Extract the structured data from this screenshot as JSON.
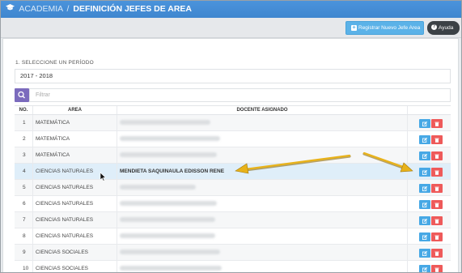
{
  "header": {
    "breadcrumb": "ACADEMIA",
    "separator": "/",
    "title": "DEFINICIÓN JEFES DE AREA"
  },
  "toolbar": {
    "register_label": "Registrar Nuevo Jefe Area",
    "help_label": "Ayuda"
  },
  "period": {
    "label": "1. SELECCIONE UN PERÍODO",
    "value": "2017 - 2018"
  },
  "search": {
    "placeholder": "Filtrar"
  },
  "table": {
    "headers": [
      "NO.",
      "AREA",
      "DOCENTE ASIGNADO",
      ""
    ],
    "rows": [
      {
        "no": "1",
        "area": "MATEMÁTICA",
        "docente": ""
      },
      {
        "no": "2",
        "area": "MATEMÁTICA",
        "docente": ""
      },
      {
        "no": "3",
        "area": "MATEMÁTICA",
        "docente": ""
      },
      {
        "no": "4",
        "area": "CIENCIAS NATURALES",
        "docente": "MENDIETA SAQUINAULA EDISSON RENE"
      },
      {
        "no": "5",
        "area": "CIENCIAS NATURALES",
        "docente": ""
      },
      {
        "no": "6",
        "area": "CIENCIAS NATURALES",
        "docente": ""
      },
      {
        "no": "7",
        "area": "CIENCIAS NATURALES",
        "docente": ""
      },
      {
        "no": "8",
        "area": "CIENCIAS NATURALES",
        "docente": ""
      },
      {
        "no": "9",
        "area": "CIENCIAS SOCIALES",
        "docente": ""
      },
      {
        "no": "10",
        "area": "CIENCIAS SOCIALES",
        "docente": ""
      }
    ]
  },
  "colors": {
    "header_bg": "#4a90d9",
    "register_btn": "#5bb2e8",
    "help_btn": "#3b4146",
    "search_btn": "#7b6bbd",
    "edit_btn": "#47a8e5",
    "delete_btn": "#ee5a5a",
    "arrow": "#e8b21a",
    "highlight_row": "#dfeef9"
  },
  "icons": {
    "header": "graduation-cap-icon",
    "register": "plus-square-icon",
    "help": "question-circle-icon",
    "search": "search-icon",
    "edit": "edit-icon",
    "delete": "trash-icon"
  }
}
